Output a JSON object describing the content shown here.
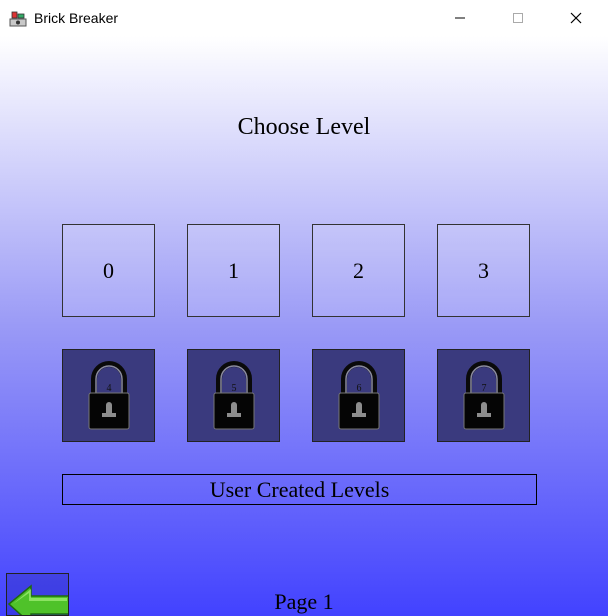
{
  "window": {
    "title": "Brick Breaker",
    "icon": "brick-breaker-app-icon",
    "controls": [
      "minimize-icon",
      "maximize-icon",
      "close-icon"
    ]
  },
  "screen": {
    "heading": "Choose Level",
    "levels": [
      {
        "label": "0",
        "locked": false
      },
      {
        "label": "1",
        "locked": false
      },
      {
        "label": "2",
        "locked": false
      },
      {
        "label": "3",
        "locked": false
      },
      {
        "label": "4",
        "locked": true,
        "icon": "padlock-icon"
      },
      {
        "label": "5",
        "locked": true,
        "icon": "padlock-icon"
      },
      {
        "label": "6",
        "locked": true,
        "icon": "padlock-icon"
      },
      {
        "label": "7",
        "locked": true,
        "icon": "padlock-icon"
      }
    ],
    "user_levels_label": "User Created Levels",
    "back_icon": "green-left-arrow-icon",
    "page_label": "Page 1"
  },
  "colors": {
    "gradient_top": "#ffffff",
    "gradient_bottom": "#4242ff",
    "locked_tile": "#3a3a7e",
    "arrow_green": "#4fc22a"
  }
}
